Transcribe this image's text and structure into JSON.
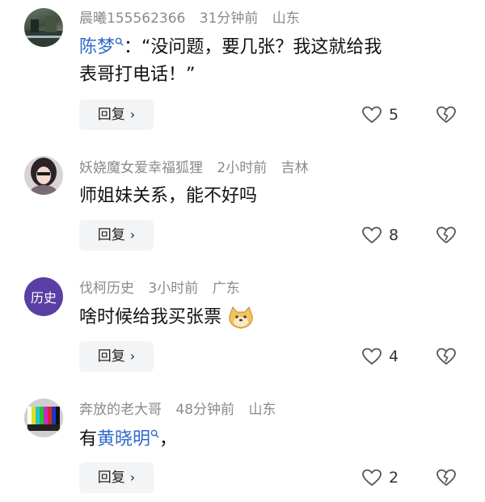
{
  "comments": [
    {
      "username": "晨曦155562366",
      "time": "31分钟前",
      "location": "山东",
      "mention": "陈梦",
      "text_after_mention": "：“没问题，要几张？我这就给我",
      "text_line2": "表哥打电话！”",
      "reply_label": "回复",
      "likes": "5"
    },
    {
      "username": "妖娆魔女爱幸福狐狸",
      "time": "2小时前",
      "location": "吉林",
      "text": "师姐妹关系，能不好吗",
      "reply_label": "回复",
      "likes": "8"
    },
    {
      "username": "伐柯历史",
      "time": "3小时前",
      "location": "广东",
      "avatar_text": "历史",
      "text": "啥时候给我买张票",
      "reply_label": "回复",
      "likes": "4"
    },
    {
      "username": "奔放的老大哥",
      "time": "48分钟前",
      "location": "山东",
      "text_before_mention": "有",
      "mention": "黄晓明",
      "text_after_mention": "，",
      "reply_label": "回复",
      "likes": "2"
    }
  ],
  "colors": {
    "mention": "#2f68c9",
    "meta": "#8a8a8a",
    "reply_bg": "#f3f4f6",
    "history_avatar_bg": "#5a3ea6"
  }
}
